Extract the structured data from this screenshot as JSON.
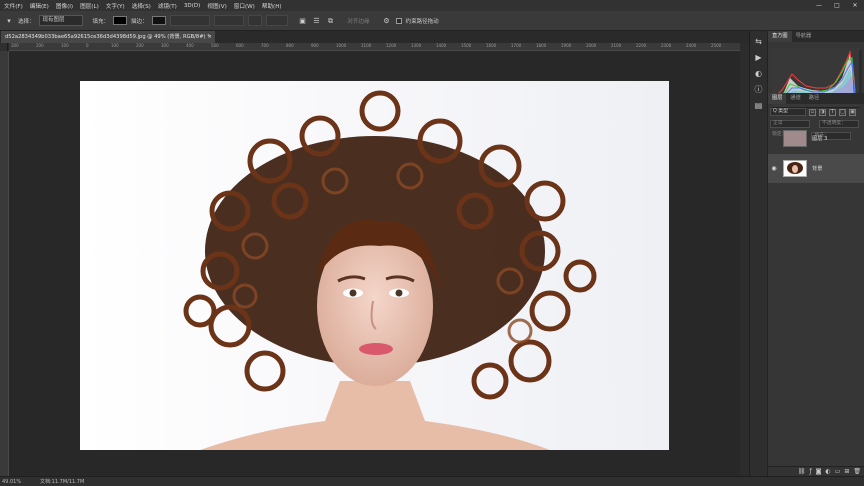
{
  "menu": [
    "文件(F)",
    "编辑(E)",
    "图像(I)",
    "图层(L)",
    "文字(Y)",
    "选择(S)",
    "滤镜(T)",
    "3D(D)",
    "视图(V)",
    "窗口(W)",
    "帮助(H)"
  ],
  "window_controls": [
    "—",
    "□",
    "✕"
  ],
  "options": {
    "select_label": "选择：",
    "select_value": "现有图层",
    "fill_label": "填充：",
    "stroke_label": "描边：",
    "align_edges": "对齐边缘",
    "constrain_label": "约束路径拖动"
  },
  "doc_tab": {
    "title": "d52a2834349b033bae65a92615ce36d3d4398d59.jpg @ 49% (背景, RGB/8#) *",
    "close": "×"
  },
  "ruler_ticks": [
    "300",
    "200",
    "100",
    "0",
    "100",
    "200",
    "300",
    "400",
    "500",
    "600",
    "700",
    "800",
    "900",
    "1000",
    "1100",
    "1200",
    "1300",
    "1400",
    "1500",
    "1600",
    "1700",
    "1800",
    "1900",
    "2000",
    "2100",
    "2200",
    "2300",
    "2400",
    "2500"
  ],
  "status": {
    "zoom": "49.01%",
    "doc": "文档:11.7M/11.7M"
  },
  "panels": {
    "top_tabs": [
      "直方图",
      "导航器"
    ],
    "layer_tabs": [
      "图层",
      "通道",
      "路径"
    ],
    "filter_kind": "Q 类型",
    "blend_mode": "正常",
    "opacity_label": "不透明度：",
    "lock_label": "锁定：",
    "fill_label": "填充：",
    "layers": [
      {
        "name": "图层 3",
        "visible": false
      },
      {
        "name": "背景",
        "visible": true
      }
    ]
  },
  "colors": {
    "accent_canvas": "#ffffff",
    "panel_bg": "#363636",
    "selected_layer": "#4a4a4a",
    "layer3_thumb": "#a08a8c"
  }
}
